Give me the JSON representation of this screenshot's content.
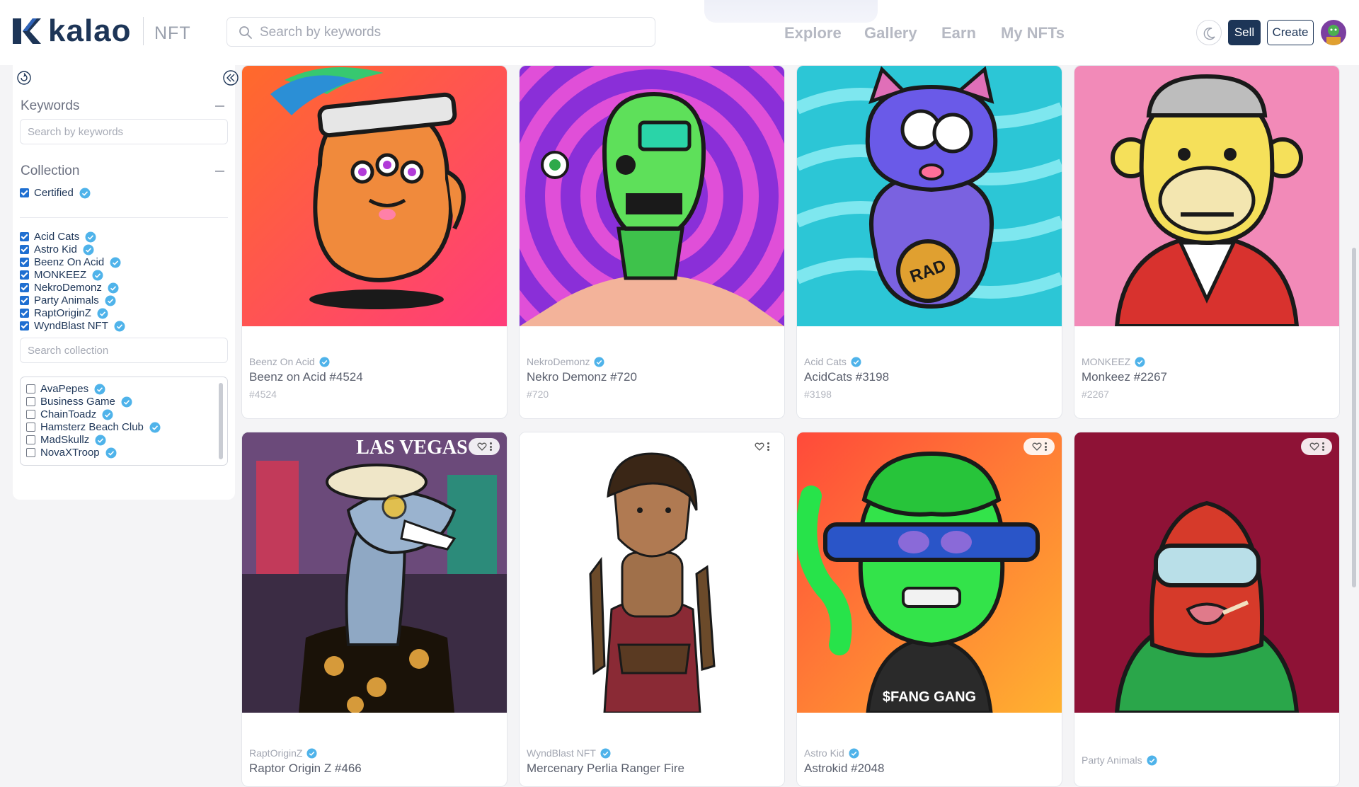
{
  "header": {
    "logo_text": "kalao",
    "logo_sub": "NFT",
    "search_placeholder": "Search by keywords",
    "nav": [
      "Explore",
      "Gallery",
      "Earn",
      "My NFTs"
    ],
    "sell_label": "Sell",
    "create_label": "Create"
  },
  "sidebar": {
    "keywords_title": "Keywords",
    "keywords_placeholder": "Search by keywords",
    "collection_title": "Collection",
    "certified_label": "Certified",
    "selected_collections": [
      "Acid Cats",
      "Astro Kid",
      "Beenz On Acid",
      "MONKEEZ",
      "NekroDemonz",
      "Party Animals",
      "RaptOriginZ",
      "WyndBlast NFT"
    ],
    "search_collection_placeholder": "Search collection",
    "other_collections": [
      "AvaPepes",
      "Business Game",
      "ChainToadz",
      "Hamsterz Beach Club",
      "MadSkullz",
      "NovaXTroop"
    ]
  },
  "cards": [
    {
      "collection": "Beenz On Acid",
      "name": "Beenz on Acid #4524",
      "token": "#4524"
    },
    {
      "collection": "NekroDemonz",
      "name": "Nekro Demonz #720",
      "token": "#720"
    },
    {
      "collection": "Acid Cats",
      "name": "AcidCats #3198",
      "token": "#3198"
    },
    {
      "collection": "MONKEEZ",
      "name": "Monkeez #2267",
      "token": "#2267"
    },
    {
      "collection": "RaptOriginZ",
      "name": "Raptor Origin Z #466",
      "token": ""
    },
    {
      "collection": "WyndBlast NFT",
      "name": "Mercenary Perlia Ranger Fire",
      "token": ""
    },
    {
      "collection": "Astro Kid",
      "name": "Astrokid #2048",
      "token": ""
    },
    {
      "collection": "Party Animals",
      "name": "",
      "token": ""
    }
  ],
  "art_text": {
    "rad_coin": "RAD",
    "las_vegas": "LAS VEGAS",
    "jersey": "$FANG GANG"
  },
  "colors": {
    "brand_navy": "#1d3557",
    "verified_blue": "#4fb3ea",
    "checkbox_blue": "#1f6fd1"
  }
}
